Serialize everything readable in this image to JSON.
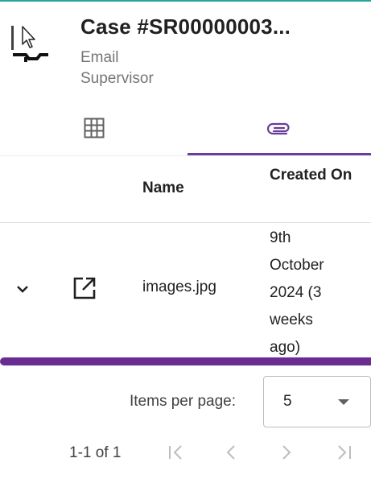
{
  "header": {
    "title": "Case #SR00000003...",
    "subtitle": "Email Supervisor"
  },
  "tabs": [
    {
      "icon": "grid-icon",
      "selected": false
    },
    {
      "icon": "paperclip-icon",
      "selected": true
    }
  ],
  "table": {
    "columns": [
      "Name",
      "Created On"
    ],
    "rows": [
      {
        "name": "images.jpg",
        "created_on": "9th October 2024 (3 weeks ago)"
      }
    ]
  },
  "paginator": {
    "items_per_page_label": "Items per page:",
    "items_per_page_value": "5",
    "range_label": "1-1 of 1"
  },
  "colors": {
    "accent": "#6a3d9a",
    "top_accent": "#26a69a",
    "scrollbar": "#6a2c91"
  }
}
